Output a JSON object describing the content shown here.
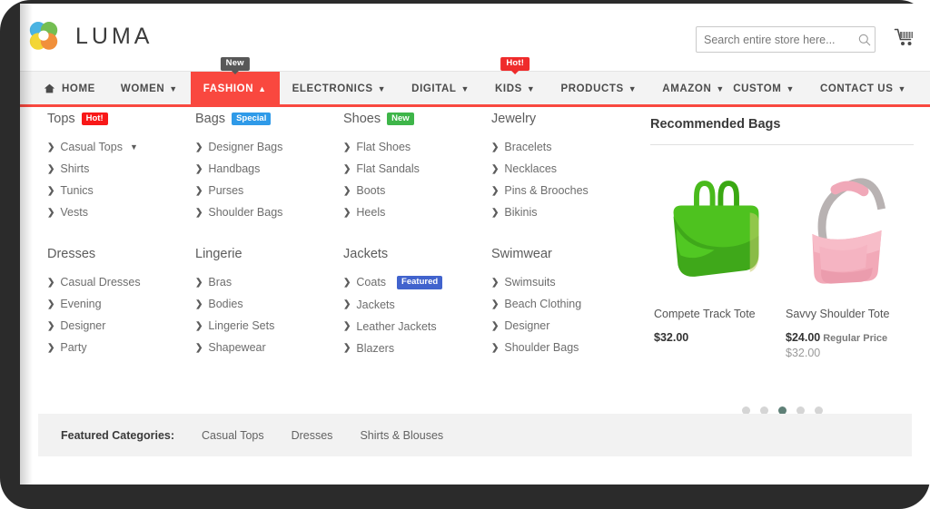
{
  "header": {
    "brand": "LUMA",
    "logo_icon": "luma-circles-logo",
    "search": {
      "placeholder": "Search entire store here...",
      "value": "",
      "icon": "search-icon"
    },
    "cart_icon": "shopping-cart-icon"
  },
  "nav": {
    "left_items": [
      {
        "label": "HOME",
        "icon": "home-icon",
        "caret": false,
        "active": false,
        "badge": null
      },
      {
        "label": "WOMEN",
        "icon": null,
        "caret": true,
        "active": false,
        "badge": null
      },
      {
        "label": "FASHION",
        "icon": null,
        "caret": true,
        "caret_up": true,
        "active": true,
        "badge": {
          "text": "New",
          "style": "dark"
        }
      },
      {
        "label": "ELECTRONICS",
        "icon": null,
        "caret": true,
        "active": false,
        "badge": null
      },
      {
        "label": "DIGITAL",
        "icon": null,
        "caret": true,
        "active": false,
        "badge": null
      },
      {
        "label": "KIDS",
        "icon": null,
        "caret": true,
        "active": false,
        "badge": {
          "text": "Hot!",
          "style": "red"
        }
      },
      {
        "label": "PRODUCTS",
        "icon": null,
        "caret": true,
        "active": false,
        "badge": null
      },
      {
        "label": "AMAZON",
        "icon": null,
        "caret": true,
        "active": false,
        "badge": null
      }
    ],
    "right_items": [
      {
        "label": "CUSTOM",
        "caret": true
      },
      {
        "label": "CONTACT US",
        "caret": true
      }
    ]
  },
  "mega_menu": {
    "columns": [
      {
        "groups": [
          {
            "title": "Tops",
            "badge": {
              "text": "Hot!",
              "style": "hot"
            },
            "items": [
              {
                "label": "Casual Tops",
                "has_caret": true
              },
              {
                "label": "Shirts",
                "has_caret": false
              },
              {
                "label": "Tunics",
                "has_caret": false
              },
              {
                "label": "Vests",
                "has_caret": false
              }
            ]
          },
          {
            "title": "Dresses",
            "badge": null,
            "items": [
              {
                "label": "Casual Dresses",
                "has_caret": false
              },
              {
                "label": "Evening",
                "has_caret": false
              },
              {
                "label": "Designer",
                "has_caret": false
              },
              {
                "label": "Party",
                "has_caret": false
              }
            ]
          }
        ]
      },
      {
        "groups": [
          {
            "title": "Bags",
            "badge": {
              "text": "Special",
              "style": "special"
            },
            "items": [
              {
                "label": "Designer Bags",
                "has_caret": false
              },
              {
                "label": "Handbags",
                "has_caret": false
              },
              {
                "label": "Purses",
                "has_caret": false
              },
              {
                "label": "Shoulder Bags",
                "has_caret": false
              }
            ]
          },
          {
            "title": "Lingerie",
            "badge": null,
            "items": [
              {
                "label": "Bras",
                "has_caret": false
              },
              {
                "label": "Bodies",
                "has_caret": false
              },
              {
                "label": "Lingerie Sets",
                "has_caret": false
              },
              {
                "label": "Shapewear",
                "has_caret": false
              }
            ]
          }
        ]
      },
      {
        "groups": [
          {
            "title": "Shoes",
            "badge": {
              "text": "New",
              "style": "new"
            },
            "items": [
              {
                "label": "Flat Shoes",
                "has_caret": false
              },
              {
                "label": "Flat Sandals",
                "has_caret": false
              },
              {
                "label": "Boots",
                "has_caret": false
              },
              {
                "label": "Heels",
                "has_caret": false
              }
            ]
          },
          {
            "title": "Jackets",
            "badge": null,
            "items": [
              {
                "label": "Coats",
                "has_caret": false,
                "badge": {
                  "text": "Featured",
                  "style": "featured"
                }
              },
              {
                "label": "Jackets",
                "has_caret": false
              },
              {
                "label": "Leather Jackets",
                "has_caret": false
              },
              {
                "label": "Blazers",
                "has_caret": false
              }
            ]
          }
        ]
      },
      {
        "groups": [
          {
            "title": "Jewelry",
            "badge": null,
            "items": [
              {
                "label": "Bracelets",
                "has_caret": false
              },
              {
                "label": "Necklaces",
                "has_caret": false
              },
              {
                "label": "Pins & Brooches",
                "has_caret": false
              },
              {
                "label": "Bikinis",
                "has_caret": false
              }
            ]
          },
          {
            "title": "Swimwear",
            "badge": null,
            "items": [
              {
                "label": "Swimsuits",
                "has_caret": false
              },
              {
                "label": "Beach Clothing",
                "has_caret": false
              },
              {
                "label": "Designer",
                "has_caret": false
              },
              {
                "label": "Shoulder Bags",
                "has_caret": false
              }
            ]
          }
        ]
      }
    ]
  },
  "recommended": {
    "title": "Recommended Bags",
    "products": [
      {
        "name": "Compete Track Tote",
        "image": "green-tote-bag",
        "price": "$32.00",
        "regular_price_label": null,
        "old_price": null
      },
      {
        "name": "Savvy Shoulder Tote",
        "image": "pink-shoulder-bag",
        "price": "$24.00",
        "regular_price_label": "Regular Price",
        "old_price": "$32.00"
      }
    ],
    "carousel": {
      "total": 5,
      "active_index": 2
    }
  },
  "featured_categories": {
    "label": "Featured Categories:",
    "items": [
      "Casual Tops",
      "Dresses",
      "Shirts & Blouses"
    ]
  },
  "colors": {
    "accent_red": "#f9483f",
    "badge_hot": "#f81818",
    "badge_special": "#2f9ae8",
    "badge_new": "#3eb549",
    "badge_featured": "#4163cd",
    "dot_active": "#5f8077"
  }
}
